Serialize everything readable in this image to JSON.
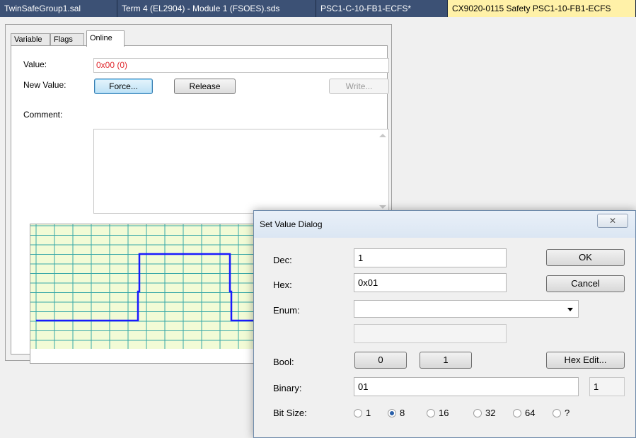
{
  "doc_tabs": [
    {
      "label": "TwinSafeGroup1.sal"
    },
    {
      "label": "Term 4 (EL2904) - Module 1 (FSOES).sds"
    },
    {
      "label": "PSC1-C-10-FB1-ECFS*"
    },
    {
      "label": "CX9020-0115 Safety PSC1-10-FB1-ECFS"
    }
  ],
  "panel": {
    "tabs": [
      {
        "label": "Variable"
      },
      {
        "label": "Flags"
      },
      {
        "label": "Online"
      }
    ],
    "value_label": "Value:",
    "value": "0x00 (0)",
    "new_value_label": "New Value:",
    "force_button": "Force...",
    "release_button": "Release",
    "write_button": "Write...",
    "comment_label": "Comment:"
  },
  "dialog": {
    "title": "Set Value Dialog",
    "close_glyph": "✕",
    "dec_label": "Dec:",
    "dec_value": "1",
    "hex_label": "Hex:",
    "hex_value": "0x01",
    "enum_label": "Enum:",
    "enum_value": "",
    "ok_button": "OK",
    "cancel_button": "Cancel",
    "bool_label": "Bool:",
    "bool_false": "0",
    "bool_true": "1",
    "hex_edit_button": "Hex Edit...",
    "binary_label": "Binary:",
    "binary_value": "01",
    "binary_length": "1",
    "bitsize_label": "Bit Size:",
    "bitsizes": [
      {
        "label": "1",
        "selected": false
      },
      {
        "label": "8",
        "selected": true
      },
      {
        "label": "16",
        "selected": false
      },
      {
        "label": "32",
        "selected": false
      },
      {
        "label": "64",
        "selected": false
      },
      {
        "label": "?",
        "selected": false
      }
    ]
  },
  "colors": {
    "value_text": "#e0262b",
    "signal_line": "#1a1aff",
    "grid_fill": "#f2fbd6",
    "grid_line": "#38a8a8"
  }
}
